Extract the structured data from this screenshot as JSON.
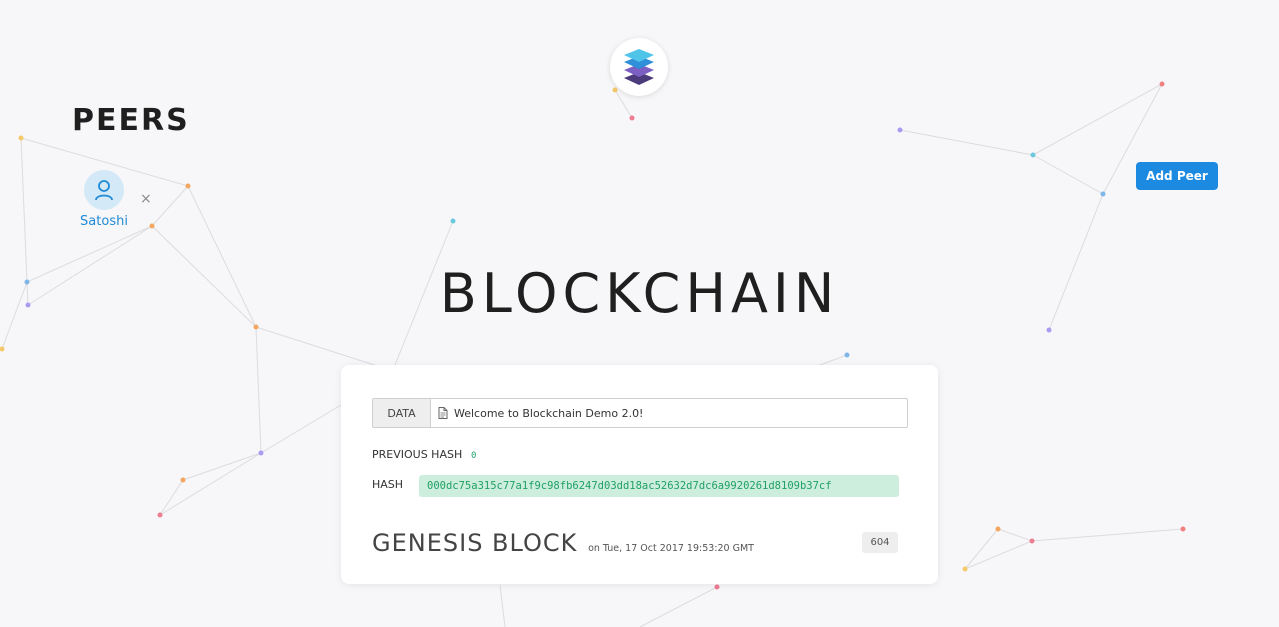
{
  "peers": {
    "title": "PEERS",
    "items": [
      {
        "name": "Satoshi",
        "remove_symbol": "×",
        "icon": "user-icon"
      }
    ],
    "add_button_label": "Add Peer"
  },
  "app": {
    "logo_icon": "stacked-layers-logo",
    "title": "BLOCKCHAIN"
  },
  "block": {
    "data_label": "DATA",
    "data_value": "Welcome to Blockchain Demo 2.0!",
    "data_icon": "document-icon",
    "previous_hash_label": "PREVIOUS HASH",
    "previous_hash_value": "0",
    "hash_label": "HASH",
    "hash_value": "000dc75a315c77a1f9c98fb6247d03dd18ac52632d7dc6a9920261d8109b37cf",
    "title": "GENESIS BLOCK",
    "timestamp": "on Tue, 17 Oct 2017 19:53:20 GMT",
    "nonce": "604"
  },
  "colors": {
    "accent": "#1d8ae1",
    "hash_bg": "#cdeedd",
    "hash_text": "#20a064",
    "background": "#f7f7f9"
  }
}
